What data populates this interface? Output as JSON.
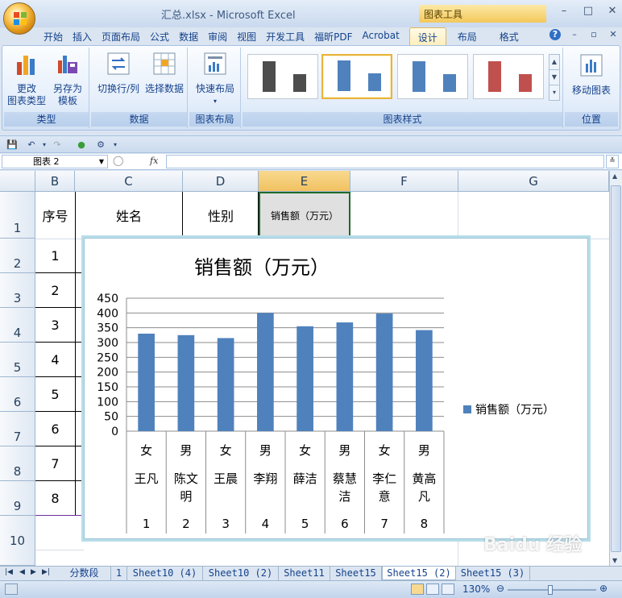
{
  "window": {
    "title": "汇总.xlsx - Microsoft Excel",
    "context_tab_group": "图表工具",
    "controls": [
      "–",
      "□",
      "✕"
    ]
  },
  "tabs": [
    {
      "label": "开始",
      "active": false
    },
    {
      "label": "插入",
      "active": false
    },
    {
      "label": "页面布局",
      "active": false
    },
    {
      "label": "公式",
      "active": false
    },
    {
      "label": "数据",
      "active": false
    },
    {
      "label": "审阅",
      "active": false
    },
    {
      "label": "视图",
      "active": false
    },
    {
      "label": "开发工具",
      "active": false
    },
    {
      "label": "福昕PDF",
      "active": false
    },
    {
      "label": "Acrobat",
      "active": false
    },
    {
      "label": "设计",
      "active": true
    },
    {
      "label": "布局",
      "active": false
    },
    {
      "label": "格式",
      "active": false
    }
  ],
  "ribbon": {
    "groups": {
      "type": {
        "label": "类型",
        "change_type": "更改\n图表类型",
        "save_template": "另存为\n模板"
      },
      "data": {
        "label": "数据",
        "switch_row_col": "切换行/列",
        "select_data": "选择数据"
      },
      "layout": {
        "label": "图表布局",
        "quick_layout": "快速布局"
      },
      "styles": {
        "label": "图表样式"
      },
      "location": {
        "label": "位置",
        "move_chart": "移动图表"
      }
    }
  },
  "formula_bar": {
    "name_box": "图表 2",
    "fx": "fx",
    "value": ""
  },
  "sheet": {
    "columns": [
      "B",
      "C",
      "D",
      "E",
      "F",
      "G"
    ],
    "rows": [
      "1",
      "2",
      "3",
      "4",
      "5",
      "6",
      "7",
      "8",
      "9",
      "10"
    ],
    "header_row": {
      "B": "序号",
      "C": "姓名",
      "D": "性别",
      "E": "销售额（万元）"
    },
    "index_values": [
      "1",
      "2",
      "3",
      "4",
      "5",
      "6",
      "7",
      "8"
    ]
  },
  "chart_data": {
    "type": "bar",
    "title": "销售额（万元）",
    "legend": "销售额（万元）",
    "legend_position": "right",
    "yticks": [
      "0",
      "50",
      "100",
      "150",
      "200",
      "250",
      "300",
      "350",
      "400",
      "450"
    ],
    "ylim": [
      0,
      450
    ],
    "grid": true,
    "categories": [
      {
        "gender": "女",
        "name": "王凡",
        "index": "1"
      },
      {
        "gender": "男",
        "name": "陈文\n明",
        "index": "2"
      },
      {
        "gender": "女",
        "name": "王晨",
        "index": "3"
      },
      {
        "gender": "男",
        "name": "李翔",
        "index": "4"
      },
      {
        "gender": "女",
        "name": "薛洁",
        "index": "5"
      },
      {
        "gender": "男",
        "name": "蔡慧\n洁",
        "index": "6"
      },
      {
        "gender": "女",
        "name": "李仁\n意",
        "index": "7"
      },
      {
        "gender": "男",
        "name": "黄高\n凡",
        "index": "8"
      }
    ],
    "series": [
      {
        "name": "销售额（万元）",
        "values": [
          330,
          325,
          315,
          400,
          355,
          368,
          398,
          342
        ],
        "color": "#4f81bd"
      }
    ]
  },
  "sheet_tabs": [
    {
      "label": "分数段",
      "active": false
    },
    {
      "label": "1",
      "active": false
    },
    {
      "label": "Sheet10 (4)",
      "active": false
    },
    {
      "label": "Sheet10 (2)",
      "active": false
    },
    {
      "label": "Sheet11",
      "active": false
    },
    {
      "label": "Sheet15",
      "active": false
    },
    {
      "label": "Sheet15 (2)",
      "active": true
    },
    {
      "label": "Sheet15 (3)",
      "active": false
    }
  ],
  "status": {
    "zoom": "130%"
  },
  "watermark": "Baidu 经验"
}
